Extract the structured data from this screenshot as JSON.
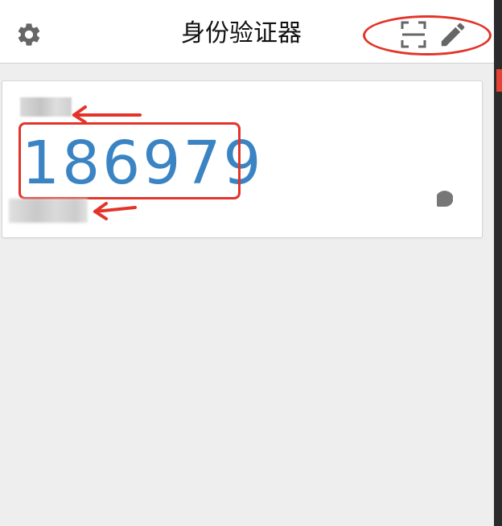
{
  "header": {
    "title": "身份验证器",
    "settings_icon": "gear-icon",
    "scan_icon": "scan-qr-icon",
    "edit_icon": "pencil-icon"
  },
  "account_card": {
    "code": "186979",
    "timer_icon": "countdown-pie-icon"
  },
  "colors": {
    "code": "#3b84c4",
    "annotation": "#e3342a",
    "icon": "#666666",
    "background": "#eeeeee"
  }
}
